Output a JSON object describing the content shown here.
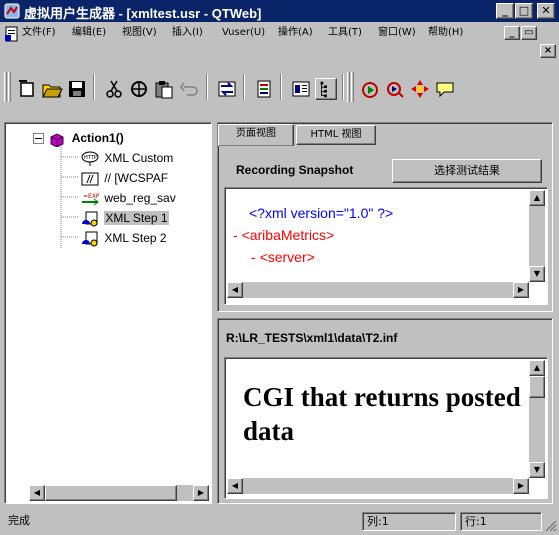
{
  "window": {
    "title": "虚拟用户生成器 - [xmltest.usr - QTWeb]",
    "title_bar_color": "#0a246a",
    "caption_buttons": {
      "minimize": "_",
      "maximize": "□",
      "close": "✕"
    }
  },
  "menu": {
    "items": [
      "文件(F)",
      "编辑(E)",
      "视图(V)",
      "插入(I)",
      "Vuser(U)",
      "操作(A)",
      "工具(T)",
      "窗口(W)",
      "帮助(H)"
    ],
    "mdi_buttons": {
      "minimize": "_",
      "restore": "▭",
      "close": "×"
    }
  },
  "toolbar": {
    "buttons": [
      "new-script-icon",
      "open-folder-icon",
      "save-icon",
      "cut-icon",
      "copy-icon",
      "paste-icon",
      "undo-icon",
      "compile-icon",
      "tree-view-icon",
      "script-view-icon",
      "thumbnail-view-icon",
      "run-icon",
      "step-icon",
      "breakpoint-icon",
      "comment-icon"
    ]
  },
  "tree": {
    "root": "Action1()",
    "items": [
      {
        "label": "XML Custom",
        "icon": "http-request-icon",
        "selected": false
      },
      {
        "label": "// [WCSPAF",
        "icon": "comment-step-icon",
        "selected": false
      },
      {
        "label": "web_reg_sav",
        "icon": "expression-icon",
        "selected": false
      },
      {
        "label": "XML Step 1",
        "icon": "xml-step-icon",
        "selected": true
      },
      {
        "label": "XML Step 2",
        "icon": "xml-step-icon",
        "selected": false
      }
    ]
  },
  "snapshot_pane": {
    "tabs": [
      "页面视图",
      "HTML 视图"
    ],
    "label": "Recording Snapshot",
    "select_button": "选择测试结果",
    "xml_lines": [
      {
        "prefix": "",
        "text": "<?xml version=\"1.0\" ?>",
        "color": "#0000ff",
        "indent": 1
      },
      {
        "prefix": "- ",
        "text": "<aribaMetrics>",
        "color": "#ff0000",
        "indent": 0
      },
      {
        "prefix": "- ",
        "text": "<server>",
        "color": "#ff0000",
        "indent": 1
      }
    ]
  },
  "result_pane": {
    "path": "R:\\LR_TESTS\\xml1\\data\\T2.inf",
    "content": "CGI that returns posted data"
  },
  "status": {
    "text": "完成",
    "column": "列:1",
    "row": "行:1"
  }
}
